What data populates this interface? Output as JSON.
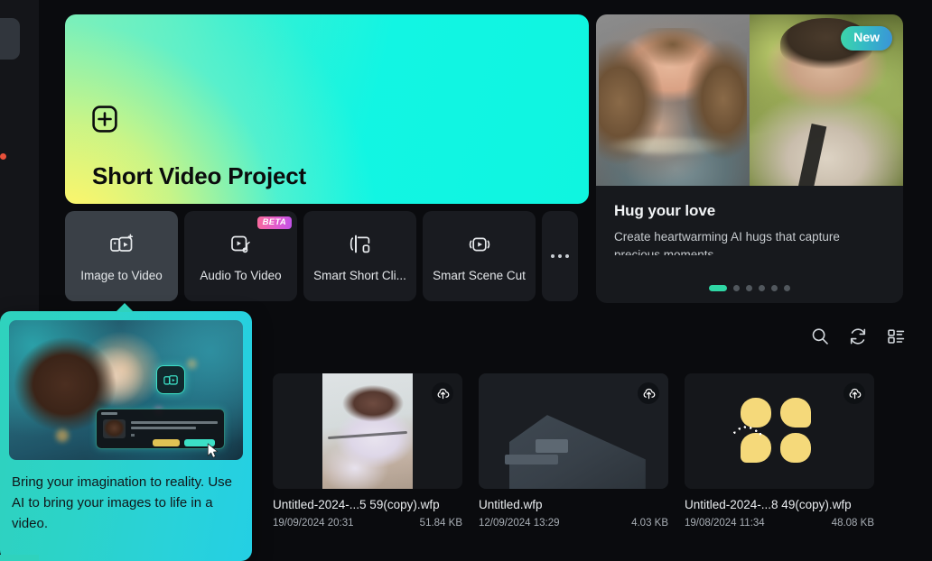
{
  "hero": {
    "title": "Short Video Project",
    "plus_icon": "plus-square-icon"
  },
  "promo": {
    "badge": "New",
    "title": "Hug your love",
    "description": "Create heartwarming AI hugs that capture precious moments.",
    "dots_total": 6,
    "dots_active_index": 0,
    "accent_color": "#2fd6a4"
  },
  "tools": [
    {
      "label": "Image to Video",
      "icon": "image-to-video-icon",
      "active": true,
      "badge": null
    },
    {
      "label": "Audio To Video",
      "icon": "audio-to-video-icon",
      "active": false,
      "badge": "BETA"
    },
    {
      "label": "Smart Short Cli...",
      "icon": "smart-short-clip-icon",
      "active": false,
      "badge": null
    },
    {
      "label": "Smart Scene Cut",
      "icon": "smart-scene-cut-icon",
      "active": false,
      "badge": null
    }
  ],
  "tools_more": {
    "label": "...",
    "icon": "ellipsis-icon"
  },
  "files_toolbar": [
    {
      "name": "search-icon",
      "label": "Search"
    },
    {
      "name": "refresh-icon",
      "label": "Refresh"
    },
    {
      "name": "view-list-icon",
      "label": "View mode"
    }
  ],
  "files": [
    {
      "name": "Untitled-2024-...5 59(copy).wfp",
      "date": "19/09/2024 20:31",
      "size": "51.84 KB",
      "thumb": "portrait",
      "upload_icon": "cloud-upload-icon"
    },
    {
      "name": "Untitled.wfp",
      "date": "12/09/2024 13:29",
      "size": "4.03 KB",
      "thumb": "placeholder",
      "upload_icon": "cloud-upload-icon"
    },
    {
      "name": "Untitled-2024-...8 49(copy).wfp",
      "date": "19/08/2024 11:34",
      "size": "48.08 KB",
      "thumb": "blobs",
      "upload_icon": "cloud-upload-icon"
    }
  ],
  "tooltip": {
    "text": "Bring your imagination to reality. Use AI to bring your images to life in a video.",
    "chip_icon": "image-to-video-icon",
    "cursor_icon": "cursor-arrow-icon",
    "background_start": "#2fd2bd",
    "background_end": "#24cfe4"
  },
  "theme": {
    "window_bg": "#0a0b0e",
    "panel_bg": "#191b20",
    "active_tool_bg": "#3a4047",
    "accent": "#2fd2bd",
    "hero_gradient_start": "#f9f871",
    "hero_gradient_end": "#0ff5e0"
  }
}
